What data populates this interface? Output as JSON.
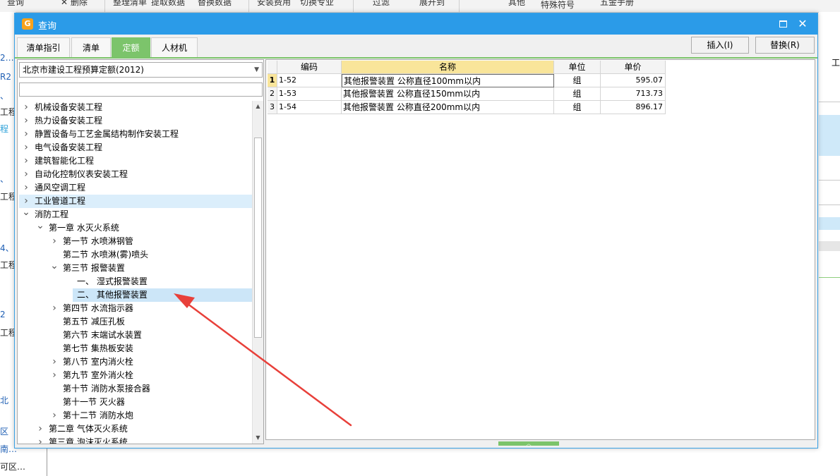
{
  "bg_toolbar": {
    "items": [
      "查询",
      "删除",
      "整理清单",
      "提取数据",
      "替换数据",
      "安装费用",
      "切换专业",
      "过滤",
      "展开到",
      "其他",
      "特殊符号",
      "五金手册"
    ]
  },
  "bg_left_texts": [
    "2…",
    "R2",
    "、",
    "工程",
    "程",
    "、",
    "工程",
    "4、",
    "工程",
    "2",
    "工程",
    "北",
    "区",
    "南…",
    "可区…"
  ],
  "bg_right_texts": [
    "工"
  ],
  "dialog": {
    "title": "查询",
    "tabs": [
      "清单指引",
      "清单",
      "定额",
      "人材机"
    ],
    "active_tab": "定额",
    "insert_label": "插入(I)",
    "replace_label": "替换(R)"
  },
  "left": {
    "quota_library": "北京市建设工程预算定额(2012)",
    "filter_value": "",
    "tree": [
      {
        "label": "机械设备安装工程",
        "level": 0,
        "arrow": "right"
      },
      {
        "label": "热力设备安装工程",
        "level": 0,
        "arrow": "right"
      },
      {
        "label": "静置设备与工艺金属结构制作安装工程",
        "level": 0,
        "arrow": "right"
      },
      {
        "label": "电气设备安装工程",
        "level": 0,
        "arrow": "right"
      },
      {
        "label": "建筑智能化工程",
        "level": 0,
        "arrow": "right"
      },
      {
        "label": "自动化控制仪表安装工程",
        "level": 0,
        "arrow": "right"
      },
      {
        "label": "通风空调工程",
        "level": 0,
        "arrow": "right"
      },
      {
        "label": "工业管道工程",
        "level": 0,
        "arrow": "right",
        "state": "hover"
      },
      {
        "label": "消防工程",
        "level": 0,
        "arrow": "down"
      },
      {
        "label": "第一章 水灭火系统",
        "level": 1,
        "arrow": "down"
      },
      {
        "label": "第一节 水喷淋钢管",
        "level": 2,
        "arrow": "right"
      },
      {
        "label": "第二节 水喷淋(雾)喷头",
        "level": 2,
        "arrow": ""
      },
      {
        "label": "第三节 报警装置",
        "level": 2,
        "arrow": "down"
      },
      {
        "label": "一、 湿式报警装置",
        "level": 3,
        "arrow": ""
      },
      {
        "label": "二、 其他报警装置",
        "level": 3,
        "arrow": "",
        "state": "selected"
      },
      {
        "label": "第四节 水流指示器",
        "level": 2,
        "arrow": "right"
      },
      {
        "label": "第五节 减压孔板",
        "level": 2,
        "arrow": ""
      },
      {
        "label": "第六节 末端试水装置",
        "level": 2,
        "arrow": ""
      },
      {
        "label": "第七节 集热板安装",
        "level": 2,
        "arrow": ""
      },
      {
        "label": "第八节 室内消火栓",
        "level": 2,
        "arrow": "right"
      },
      {
        "label": "第九节 室外消火栓",
        "level": 2,
        "arrow": "right"
      },
      {
        "label": "第十节 消防水泵接合器",
        "level": 2,
        "arrow": ""
      },
      {
        "label": "第十一节 灭火器",
        "level": 2,
        "arrow": ""
      },
      {
        "label": "第十二节 消防水炮",
        "level": 2,
        "arrow": "right"
      },
      {
        "label": "第二章 气体灭火系统",
        "level": 1,
        "arrow": "right"
      },
      {
        "label": "第三章 泡沫灭火系统",
        "level": 1,
        "arrow": "right"
      }
    ]
  },
  "grid": {
    "columns": [
      "编码",
      "名称",
      "单位",
      "单价"
    ],
    "rows": [
      {
        "num": "1",
        "code": "1-52",
        "name": "其他报警装置 公称直径100mm以内",
        "unit": "组",
        "price": "595.07"
      },
      {
        "num": "2",
        "code": "1-53",
        "name": "其他报警装置 公称直径150mm以内",
        "unit": "组",
        "price": "713.73"
      },
      {
        "num": "3",
        "code": "1-54",
        "name": "其他报警装置 公称直径200mm以内",
        "unit": "组",
        "price": "896.17"
      }
    ]
  },
  "colors": {
    "title_bar": "#2b9be8",
    "active_tab": "#7cc46b",
    "annotation_arrow": "#e8403a",
    "selected_row": "#cce6f8",
    "sorted_header": "#f9e59a"
  }
}
